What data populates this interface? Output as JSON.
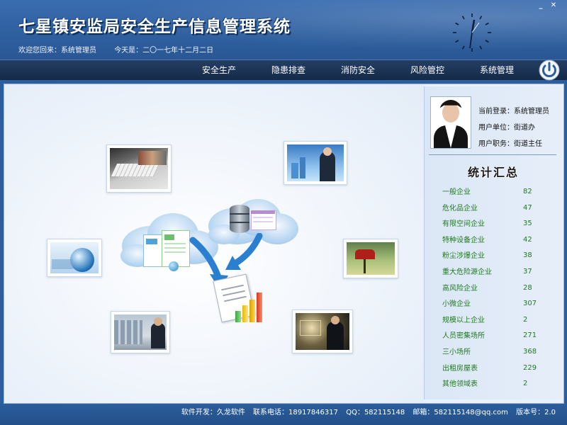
{
  "window": {
    "minimize_icon": "minimize-icon",
    "close_icon": "close-icon"
  },
  "header": {
    "title": "七星镇安监局安全生产信息管理系统",
    "welcome": "欢迎您回来：系统管理员",
    "date": "今天是：二〇一七年十二月二日"
  },
  "nav": {
    "items": [
      "安全生产",
      "隐患排查",
      "消防安全",
      "风险管控",
      "系统管理"
    ]
  },
  "user": {
    "login": "当前登录：系统管理员",
    "unit": "用户单位：街道办",
    "role": "用户职务：街道主任"
  },
  "stats": {
    "title": "统计汇总",
    "rows": [
      {
        "label": "一般企业",
        "value": "82"
      },
      {
        "label": "危化品企业",
        "value": "47"
      },
      {
        "label": "有限空间企业",
        "value": "35"
      },
      {
        "label": "特种设备企业",
        "value": "42"
      },
      {
        "label": "粉尘涉爆企业",
        "value": "38"
      },
      {
        "label": "重大危险源企业",
        "value": "37"
      },
      {
        "label": "高风险企业",
        "value": "28"
      },
      {
        "label": "小微企业",
        "value": "307"
      },
      {
        "label": "规模以上企业",
        "value": "2"
      },
      {
        "label": "人员密集场所",
        "value": "271"
      },
      {
        "label": "三小场所",
        "value": "368"
      },
      {
        "label": "出租房屋表",
        "value": "229"
      },
      {
        "label": "其他领域表",
        "value": "2"
      }
    ]
  },
  "footer": {
    "developer": "软件开发：久龙软件",
    "phone": "联系电话：18917846317",
    "qq": "QQ：582115148",
    "email": "邮箱：582115148@qq.com",
    "version": "版本号：2.0"
  },
  "colors": {
    "header_blue": "#2e5f9f",
    "nav_dark": "#152a48",
    "stat_green": "#1f7a1f"
  }
}
